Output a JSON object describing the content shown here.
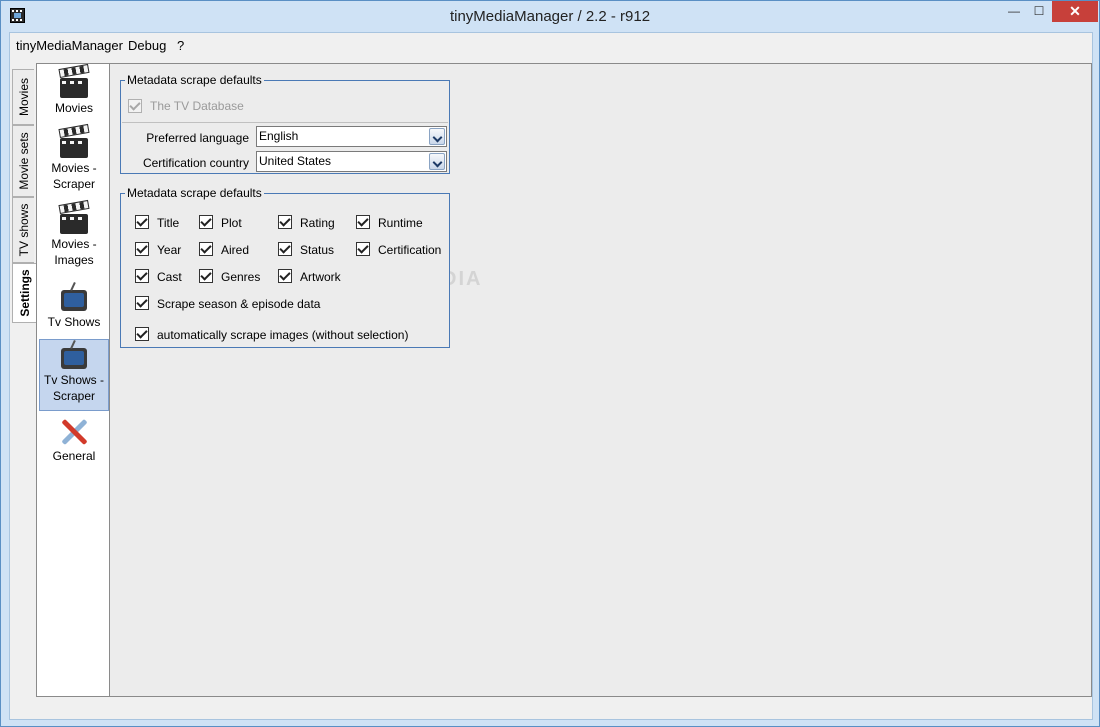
{
  "window": {
    "title": "tinyMediaManager / 2.2 - r912",
    "minimize_glyph": "—",
    "maximize_glyph": "☐",
    "close_glyph": "✕"
  },
  "menu": {
    "app": "tinyMediaManager",
    "debug": "Debug",
    "help": "?"
  },
  "tabs": {
    "movies": "Movies",
    "movie_sets": "Movie sets",
    "tv_shows": "TV shows",
    "settings": "Settings"
  },
  "nav": {
    "items": [
      {
        "label_line1": "Movies",
        "label_line2": "",
        "icon": "clapperboard-icon"
      },
      {
        "label_line1": "Movies -",
        "label_line2": "Scraper",
        "icon": "clapperboard-icon"
      },
      {
        "label_line1": "Movies -",
        "label_line2": "Images",
        "icon": "clapperboard-icon"
      },
      {
        "label_line1": "Tv Shows",
        "label_line2": "",
        "icon": "tv-icon"
      },
      {
        "label_line1": "Tv Shows -",
        "label_line2": "Scraper",
        "icon": "tv-icon",
        "selected": true
      },
      {
        "label_line1": "General",
        "label_line2": "",
        "icon": "tools-icon"
      }
    ]
  },
  "scraper_group": {
    "legend": "Metadata scrape defaults",
    "scraper_name": "The TV Database",
    "scraper_checked": true,
    "language_label": "Preferred language",
    "language_value": "English",
    "country_label": "Certification country",
    "country_value": "United States"
  },
  "fields_group": {
    "legend": "Metadata scrape defaults",
    "checkboxes": {
      "title": "Title",
      "plot": "Plot",
      "rating": "Rating",
      "runtime": "Runtime",
      "year": "Year",
      "aired": "Aired",
      "status": "Status",
      "certification": "Certification",
      "cast": "Cast",
      "genres": "Genres",
      "artwork": "Artwork",
      "season_episode": "Scrape season & episode data",
      "auto_images": "automatically scrape images (without selection)"
    }
  },
  "watermark": "SOFTPEDIA"
}
